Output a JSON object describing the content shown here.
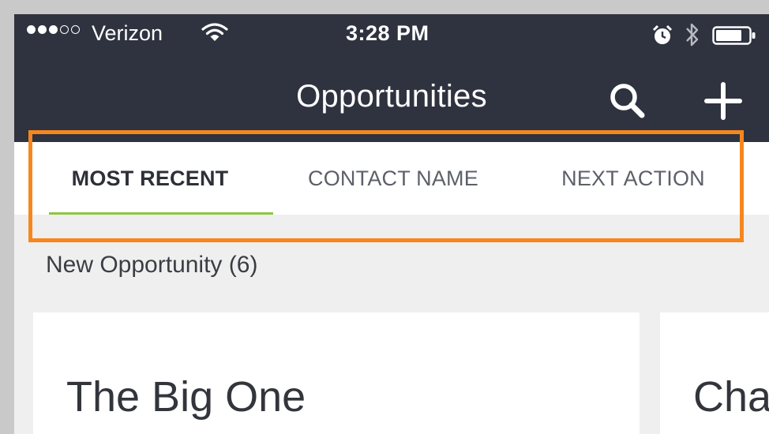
{
  "status_bar": {
    "signal_dots": [
      "full",
      "full",
      "full",
      "empty",
      "empty"
    ],
    "carrier": "Verizon",
    "time": "3:28 PM",
    "icons": [
      "wifi-icon",
      "alarm-icon",
      "bluetooth-icon",
      "battery-icon"
    ],
    "battery_level": 0.8
  },
  "header": {
    "title": "Opportunities",
    "actions": [
      "search-icon",
      "plus-icon"
    ]
  },
  "tabs": [
    {
      "label": "MOST RECENT",
      "active": true
    },
    {
      "label": "CONTACT NAME",
      "active": false
    },
    {
      "label": "NEXT ACTION",
      "active": false
    }
  ],
  "group": {
    "label": "New Opportunity (6)"
  },
  "cards": [
    {
      "title": "The Big One"
    },
    {
      "title": "Cha"
    }
  ],
  "colors": {
    "header_bg": "#2f3340",
    "tab_indicator": "#8dc63f",
    "highlight": "#f7861e",
    "background": "#efefef"
  }
}
